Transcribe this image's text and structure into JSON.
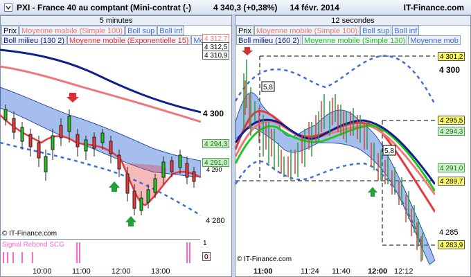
{
  "title": {
    "symbol": "PXI - France 40 au comptant (Mini-contrat  (-)",
    "price": "4 340,3 (+0,38%)",
    "date": "14 févr. 2014",
    "brand": "IT-Finance.com"
  },
  "left": {
    "interval": "5 minutes",
    "legend_row1": [
      "Prix",
      "Moyenne mobile (Simple 100)",
      "Boll sup",
      "Boll inf"
    ],
    "legend_row2": [
      "Boll milieu (130 2)",
      "Moyenne mobile (Exponentielle 15)",
      "Mo"
    ],
    "price_boxes": [
      "4 312,7",
      "4 312,5",
      "4 310,9",
      "4 294,3",
      "4 291,0"
    ],
    "y_labels": [
      "4 300",
      "4 290",
      "4 280"
    ],
    "copyright": "© IT-Finance.com",
    "indicator": "Signal Rebond SCG",
    "indicator_scale": [
      "1",
      "0"
    ],
    "time_labels": [
      "10:00",
      "11:00",
      "12:00",
      "13:00"
    ]
  },
  "right": {
    "interval": "12 secondes",
    "legend_row1": [
      "Prix",
      "Moyenne mobile (Simple 100)",
      "Boll sup",
      "Boll inf"
    ],
    "legend_row2": [
      "Boll milieu (160 2)",
      "Moyenne mobile (Simple 130)",
      "Moyenne mob"
    ],
    "price_boxes": [
      "4 301,2",
      "4 295,5",
      "4 294,3",
      "4 291,0",
      "4 289,7",
      "4 283,9"
    ],
    "y_labels": [
      "4 300",
      "4 285"
    ],
    "annotations": [
      "5,8",
      "5,8"
    ],
    "copyright": "© IT-Finance.com",
    "time_labels": [
      "11:00",
      "11:24",
      "11:40",
      "12:00",
      "12:12"
    ]
  },
  "colors": {
    "blue_band": "#3a6fd8",
    "red_ema": "#e8383a",
    "pink_sma": "#f07878",
    "navy": "#10208c",
    "green": "#22c522",
    "up_arrow": "#22a03a",
    "down_arrow": "#d83030",
    "pink_signal": "#ff66cc"
  }
}
